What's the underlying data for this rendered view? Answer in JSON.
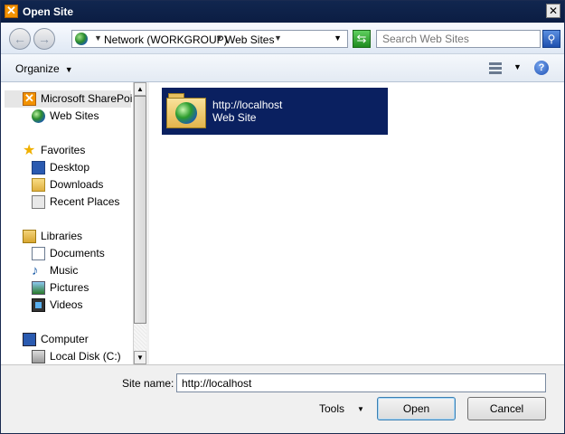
{
  "window": {
    "title": "Open Site",
    "close_glyph": "✕"
  },
  "nav": {
    "back_glyph": "←",
    "forward_glyph": "→",
    "breadcrumb": [
      "Network (WORKGROUP)",
      "Web Sites"
    ],
    "search_placeholder": "Search Web Sites"
  },
  "toolbar": {
    "organize_label": "Organize",
    "help_glyph": "?"
  },
  "sidebar": {
    "items": [
      {
        "label": "Microsoft SharePoint",
        "icon": "sharepoint-icon"
      },
      {
        "label": "Web Sites",
        "icon": "globe-icon"
      },
      {
        "label": "Favorites",
        "icon": "star-icon"
      },
      {
        "label": "Desktop",
        "icon": "desktop-icon"
      },
      {
        "label": "Downloads",
        "icon": "folder-icon"
      },
      {
        "label": "Recent Places",
        "icon": "recent-icon"
      },
      {
        "label": "Libraries",
        "icon": "libraries-icon"
      },
      {
        "label": "Documents",
        "icon": "document-icon"
      },
      {
        "label": "Music",
        "icon": "music-icon"
      },
      {
        "label": "Pictures",
        "icon": "pictures-icon"
      },
      {
        "label": "Videos",
        "icon": "videos-icon"
      },
      {
        "label": "Computer",
        "icon": "computer-icon"
      },
      {
        "label": "Local Disk (C:)",
        "icon": "disk-icon"
      }
    ]
  },
  "content": {
    "items": [
      {
        "name": "http://localhost",
        "type": "Web Site",
        "icon": "web-folder-icon"
      }
    ]
  },
  "footer": {
    "site_name_label": "Site name:",
    "site_name_value": "http://localhost",
    "tools_label": "Tools",
    "open_label": "Open",
    "cancel_label": "Cancel"
  },
  "colors": {
    "title_bar": "#0b1d43",
    "selection": "#0a2060",
    "sharepoint": "#f29200"
  }
}
